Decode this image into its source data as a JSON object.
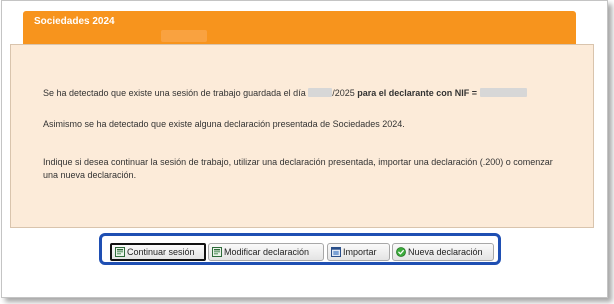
{
  "dialog": {
    "title": "Sociedades 2024"
  },
  "message": {
    "line1_prefix": "Se ha detectado que existe una sesión de trabajo guardada el día",
    "line1_date_suffix": "/2025",
    "line1_bold": "para el declarante con NIF =",
    "line2": "Asimismo se ha detectado que existe alguna declaración presentada de Sociedades 2024.",
    "line3": "Indique si desea continuar la sesión de trabajo, utilizar una declaración presentada, importar una declaración (.200) o comenzar una nueva declaración."
  },
  "buttons": {
    "continuar": "Continuar sesión",
    "modificar": "Modificar declaración",
    "importar": "Importar",
    "nueva": "Nueva declaración"
  },
  "icons": {
    "continuar": "form-document-icon",
    "modificar": "form-document-icon",
    "importar": "import-window-icon",
    "nueva": "green-check-circle-icon"
  },
  "colors": {
    "header": "#f7941d",
    "panel_background": "#fcebd9",
    "highlight_border": "#1f4fb3"
  }
}
